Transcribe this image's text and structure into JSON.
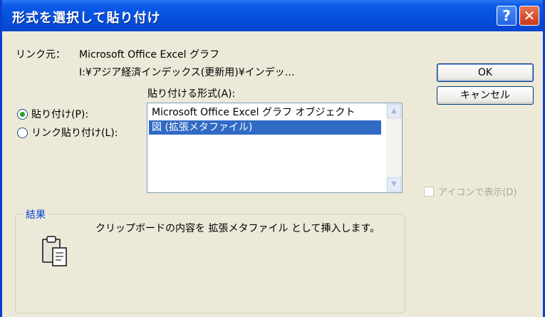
{
  "dialog": {
    "title": "形式を選択して貼り付け",
    "help_glyph": "?",
    "close_glyph": "✕"
  },
  "source": {
    "label": "リンク元：",
    "name": "Microsoft Office Excel グラフ",
    "path": "I:¥アジア経済インデックス(更新用)¥インデッ…"
  },
  "paste_as_label": "貼り付ける形式(A):",
  "options": {
    "paste": {
      "label": "貼り付け(P):",
      "selected": true
    },
    "paste_link": {
      "label": "リンク貼り付け(L):",
      "selected": false
    }
  },
  "format_list": {
    "items": [
      {
        "label": "Microsoft Office Excel グラフ オブジェクト",
        "selected": false
      },
      {
        "label": "図 (拡張メタファイル)",
        "selected": true
      }
    ]
  },
  "buttons": {
    "ok": "OK",
    "cancel": "キャンセル"
  },
  "display_as_icon": {
    "label": "アイコンで表示(D)",
    "checked": false,
    "enabled": false
  },
  "result": {
    "label": "結果",
    "text": "クリップボードの内容を 拡張メタファイル として挿入します。",
    "icon": "clipboard-icon"
  },
  "colors": {
    "titlebar": "#0750de",
    "selection": "#316ac5",
    "group_label": "#0046d5"
  }
}
